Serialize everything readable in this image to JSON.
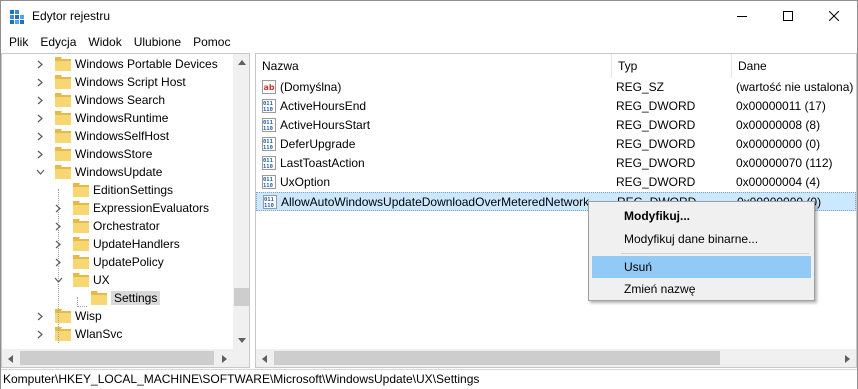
{
  "window": {
    "title": "Edytor rejestru",
    "icons": {
      "app": "registry-editor-icon",
      "minimize": "minimize-icon",
      "maximize": "maximize-icon",
      "close": "close-icon"
    }
  },
  "menu": [
    "Plik",
    "Edycja",
    "Widok",
    "Ulubione",
    "Pomoc"
  ],
  "tree": {
    "items": [
      {
        "label": "Windows Portable Devices",
        "level": 2,
        "expander": "collapsed"
      },
      {
        "label": "Windows Script Host",
        "level": 2,
        "expander": "collapsed"
      },
      {
        "label": "Windows Search",
        "level": 2,
        "expander": "collapsed"
      },
      {
        "label": "WindowsRuntime",
        "level": 2,
        "expander": "collapsed"
      },
      {
        "label": "WindowsSelfHost",
        "level": 2,
        "expander": "collapsed"
      },
      {
        "label": "WindowsStore",
        "level": 2,
        "expander": "collapsed"
      },
      {
        "label": "WindowsUpdate",
        "level": 2,
        "expander": "expanded"
      },
      {
        "label": "EditionSettings",
        "level": 3,
        "expander": "none"
      },
      {
        "label": "ExpressionEvaluators",
        "level": 3,
        "expander": "collapsed"
      },
      {
        "label": "Orchestrator",
        "level": 3,
        "expander": "collapsed"
      },
      {
        "label": "UpdateHandlers",
        "level": 3,
        "expander": "collapsed"
      },
      {
        "label": "UpdatePolicy",
        "level": 3,
        "expander": "collapsed"
      },
      {
        "label": "UX",
        "level": 3,
        "expander": "expanded"
      },
      {
        "label": "Settings",
        "level": 4,
        "expander": "none",
        "selected": true
      },
      {
        "label": "Wisp",
        "level": 2,
        "expander": "collapsed"
      },
      {
        "label": "WlanSvc",
        "level": 2,
        "expander": "collapsed"
      }
    ]
  },
  "list": {
    "columns": [
      "Nazwa",
      "Typ",
      "Dane"
    ],
    "rows": [
      {
        "icon": "string-value-icon",
        "name": "(Domyślna)",
        "type": "REG_SZ",
        "data": "(wartość nie ustalona)"
      },
      {
        "icon": "binary-value-icon",
        "name": "ActiveHoursEnd",
        "type": "REG_DWORD",
        "data": "0x00000011 (17)"
      },
      {
        "icon": "binary-value-icon",
        "name": "ActiveHoursStart",
        "type": "REG_DWORD",
        "data": "0x00000008 (8)"
      },
      {
        "icon": "binary-value-icon",
        "name": "DeferUpgrade",
        "type": "REG_DWORD",
        "data": "0x00000000 (0)"
      },
      {
        "icon": "binary-value-icon",
        "name": "LastToastAction",
        "type": "REG_DWORD",
        "data": "0x00000070 (112)"
      },
      {
        "icon": "binary-value-icon",
        "name": "UxOption",
        "type": "REG_DWORD",
        "data": "0x00000004 (4)"
      },
      {
        "icon": "binary-value-icon",
        "name": "AllowAutoWindowsUpdateDownloadOverMeteredNetwork",
        "type": "REG_DWORD",
        "data": "0x00000000 (0)",
        "selected": true
      }
    ]
  },
  "context_menu": {
    "items": [
      {
        "label": "Modyfikuj...",
        "bold": true
      },
      {
        "label": "Modyfikuj dane binarne..."
      },
      {
        "label": "Usuń",
        "highlighted": true
      },
      {
        "label": "Zmień nazwę"
      }
    ]
  },
  "status": {
    "path": "Komputer\\HKEY_LOCAL_MACHINE\\SOFTWARE\\Microsoft\\WindowsUpdate\\UX\\Settings"
  },
  "colors": {
    "folder": "#f7d774",
    "folder_dark": "#e8b94a",
    "selection": "#cce8ff",
    "menu_highlight": "#91c9f7",
    "value_icon_red": "#c0392b",
    "value_icon_blue": "#1f5fa8"
  }
}
